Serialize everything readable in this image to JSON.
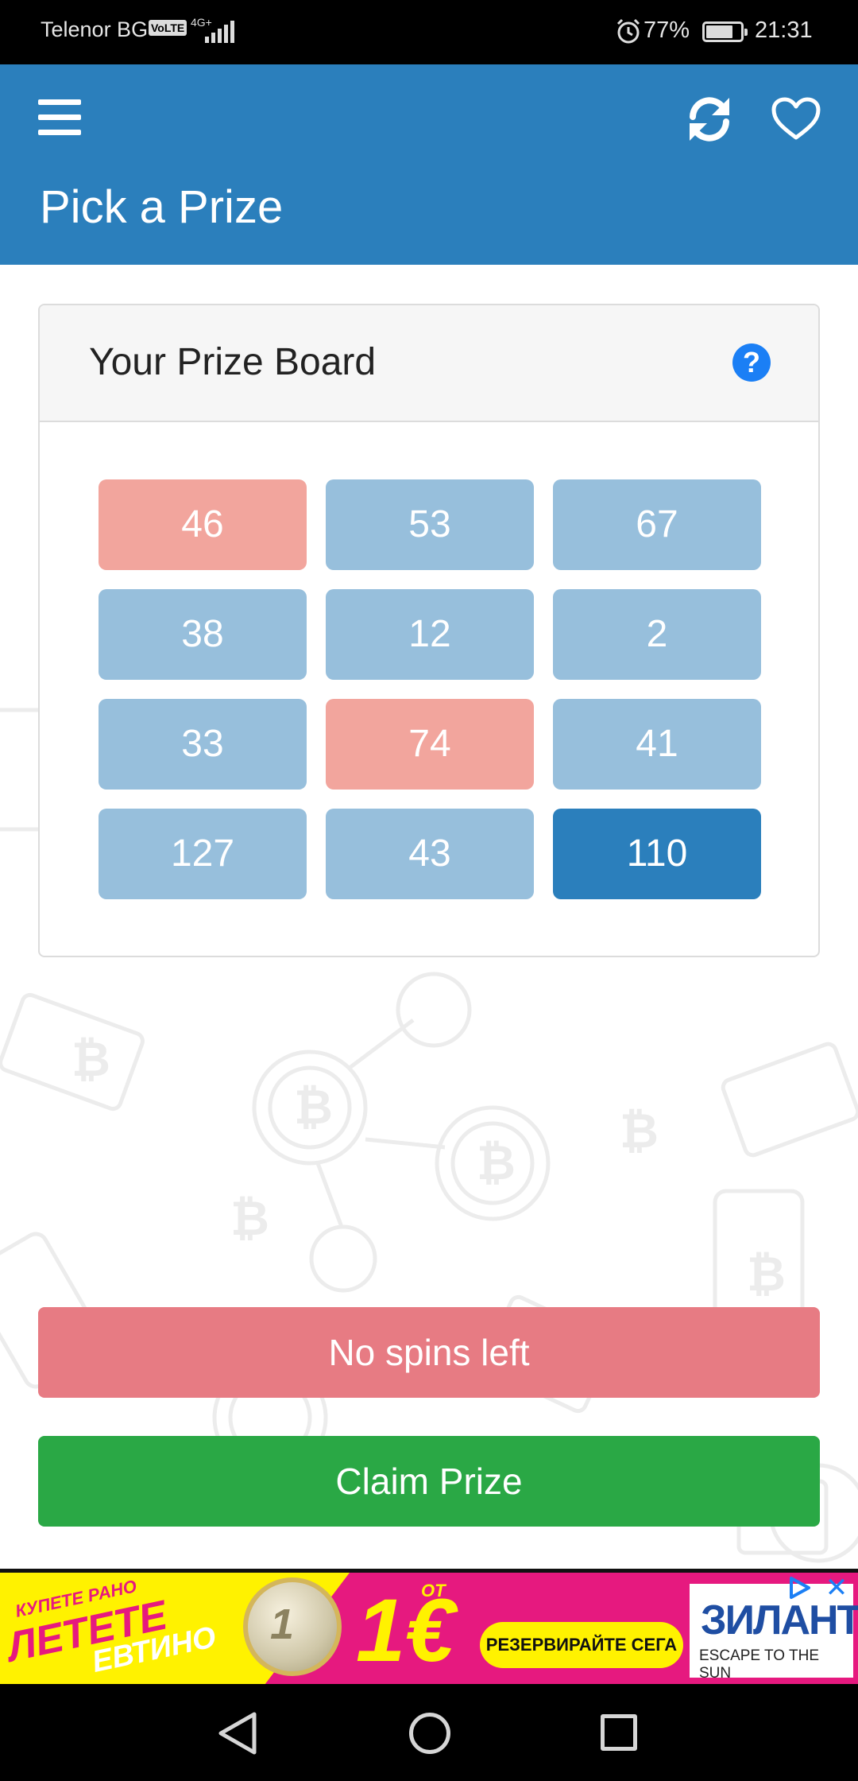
{
  "status_bar": {
    "carrier": "Telenor BG",
    "volte": "VoLTE",
    "network": "4G+",
    "battery": "77%",
    "time": "21:31"
  },
  "app_bar": {
    "title": "Pick a Prize",
    "icons": [
      "menu-icon",
      "refresh-icon",
      "heart-icon"
    ],
    "color": "#2b7fbc"
  },
  "prize_board": {
    "title": "Your Prize Board",
    "help": "?",
    "tiles": [
      {
        "value": "46",
        "state": "revealed"
      },
      {
        "value": "53",
        "state": "hidden"
      },
      {
        "value": "67",
        "state": "hidden"
      },
      {
        "value": "38",
        "state": "hidden"
      },
      {
        "value": "12",
        "state": "hidden"
      },
      {
        "value": "2",
        "state": "hidden"
      },
      {
        "value": "33",
        "state": "hidden"
      },
      {
        "value": "74",
        "state": "revealed"
      },
      {
        "value": "41",
        "state": "hidden"
      },
      {
        "value": "127",
        "state": "hidden"
      },
      {
        "value": "43",
        "state": "hidden"
      },
      {
        "value": "110",
        "state": "selected"
      }
    ],
    "colors": {
      "hidden": "#97bfdc",
      "revealed": "#f2a59d",
      "selected": "#2b7fbc"
    }
  },
  "buttons": {
    "no_spins": "No spins left",
    "claim": "Claim Prize"
  },
  "ad": {
    "line1": "КУПЕТЕ РАНО",
    "line2": "ЛЕТЕТЕ",
    "line3": "ЕВТИНО",
    "from": "ОТ",
    "price": "1€",
    "cta": "РЕЗЕРВИРАЙТЕ СЕГА ▶",
    "brand": "ЗИЛАНТ",
    "tagline": "ESCAPE TO THE SUN",
    "close": "✕"
  }
}
